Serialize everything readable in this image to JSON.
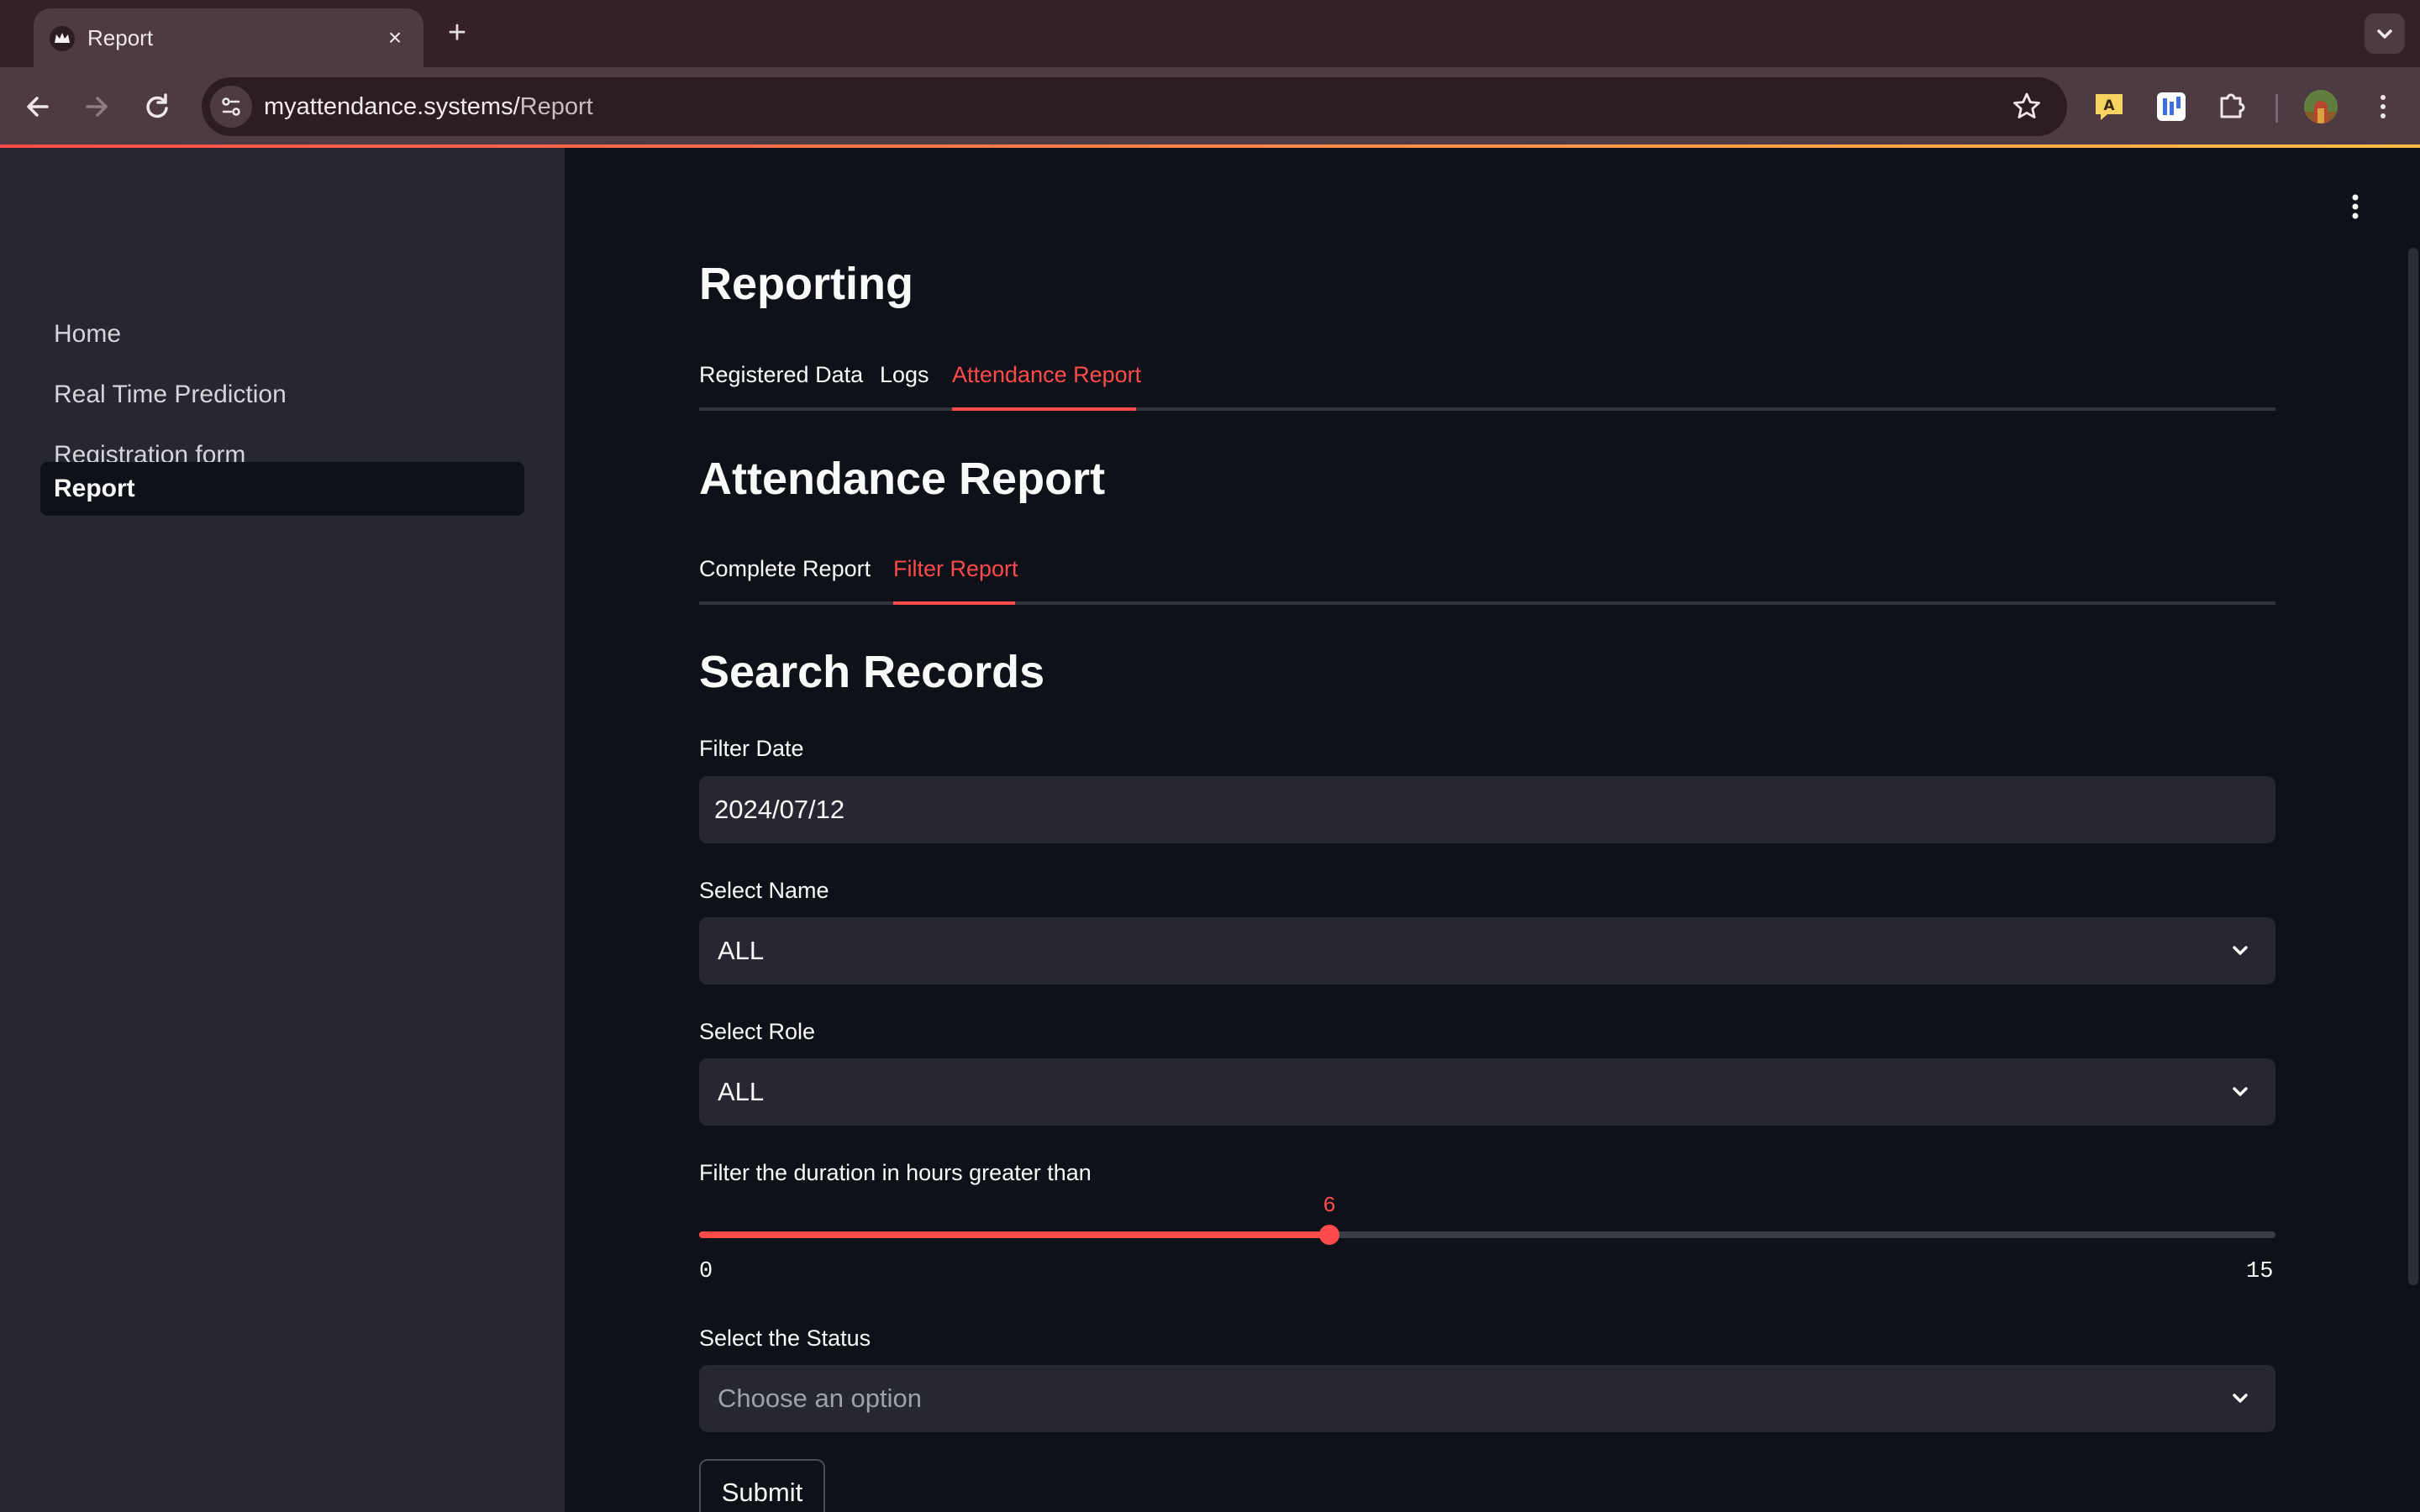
{
  "browser": {
    "tab_title": "Report",
    "url_host": "myattendance.systems/",
    "url_path": "Report",
    "icons": [
      "streamlit-crown-icon",
      "close-icon",
      "plus-icon",
      "back-icon",
      "forward-icon",
      "reload-icon",
      "site-info-icon",
      "star-icon",
      "extension-icons",
      "puzzle-icon",
      "profile-avatar",
      "menu-icon"
    ]
  },
  "sidebar": {
    "items": [
      {
        "label": "Home",
        "active": false
      },
      {
        "label": "Real Time Prediction",
        "active": false
      },
      {
        "label": "Registration form",
        "active": false
      },
      {
        "label": "Report",
        "active": true
      }
    ]
  },
  "main": {
    "title": "Reporting",
    "tabs": [
      {
        "label": "Registered Data",
        "active": false
      },
      {
        "label": "Logs",
        "active": false
      },
      {
        "label": "Attendance Report",
        "active": true
      }
    ],
    "section_title": "Attendance Report",
    "subtabs": [
      {
        "label": "Complete Report",
        "active": false
      },
      {
        "label": "Filter Report",
        "active": true
      }
    ],
    "form": {
      "title": "Search Records",
      "date": {
        "label": "Filter Date",
        "value": "2024/07/12"
      },
      "name": {
        "label": "Select Name",
        "value": "ALL"
      },
      "role": {
        "label": "Select Role",
        "value": "ALL"
      },
      "duration": {
        "label": "Filter the duration in hours greater than",
        "value": 6,
        "value_text": "6",
        "min": 0,
        "max": 15,
        "min_text": "0",
        "max_text": "15"
      },
      "status": {
        "label": "Select the Status",
        "placeholder": "Choose an option"
      },
      "submit_label": "Submit"
    }
  },
  "colors": {
    "accent": "#ff4b4b",
    "background": "#0e1117",
    "sidebar": "#262730",
    "input": "#262730",
    "browser_frame": "#4d3a43"
  }
}
